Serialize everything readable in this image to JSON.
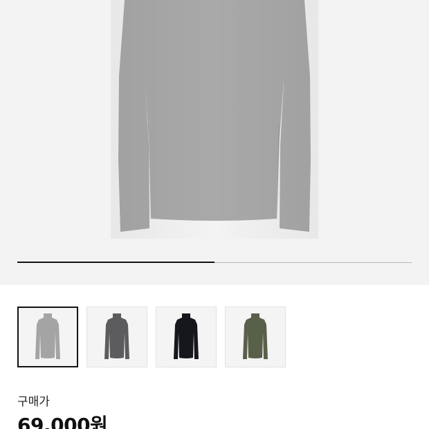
{
  "product": {
    "image": {
      "icon": "turtleneck-long-sleeve-photo",
      "color": "#a9a9a9"
    },
    "carousel": {
      "progress_fraction": 0.5
    },
    "color_options": [
      {
        "icon": "turtleneck-thumbnail",
        "color": "#a4a4a4",
        "selected": true
      },
      {
        "icon": "turtleneck-thumbnail",
        "color": "#5c5c5f",
        "selected": false
      },
      {
        "icon": "turtleneck-thumbnail",
        "color": "#15171c",
        "selected": false
      },
      {
        "icon": "turtleneck-thumbnail",
        "color": "#59604a",
        "selected": false
      }
    ],
    "price": {
      "label": "구매가",
      "value": "69,000원"
    }
  }
}
